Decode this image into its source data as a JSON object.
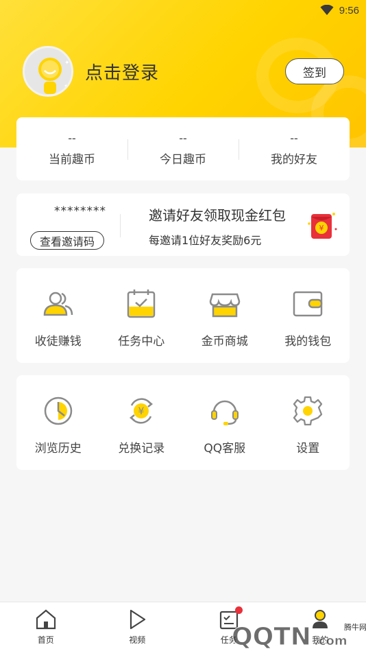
{
  "status_bar": {
    "time": "9:56",
    "wifi_icon": "wifi-icon"
  },
  "profile": {
    "login_text": "点击登录",
    "signin_label": "签到"
  },
  "stats": [
    {
      "value": "--",
      "label": "当前趣币"
    },
    {
      "value": "--",
      "label": "今日趣币"
    },
    {
      "value": "--",
      "label": "我的好友"
    }
  ],
  "invite": {
    "code": "********",
    "view_code_label": "查看邀请码",
    "title": "邀请好友领取现金红包",
    "subtitle": "每邀请1位好友奖励6元",
    "icon": "red-packet-icon"
  },
  "menu_row1": [
    {
      "label": "收徒赚钱",
      "icon": "users-icon"
    },
    {
      "label": "任务中心",
      "icon": "calendar-check-icon"
    },
    {
      "label": "金币商城",
      "icon": "shop-icon"
    },
    {
      "label": "我的钱包",
      "icon": "wallet-icon"
    }
  ],
  "menu_row2": [
    {
      "label": "浏览历史",
      "icon": "clock-icon"
    },
    {
      "label": "兑换记录",
      "icon": "yen-exchange-icon"
    },
    {
      "label": "QQ客服",
      "icon": "headset-icon"
    },
    {
      "label": "设置",
      "icon": "gear-icon"
    }
  ],
  "tabbar": [
    {
      "label": "首页",
      "icon": "home-icon"
    },
    {
      "label": "视频",
      "icon": "play-icon"
    },
    {
      "label": "任务",
      "icon": "task-icon"
    },
    {
      "label": "我的",
      "icon": "profile-icon"
    }
  ],
  "watermark": {
    "text": "QQTN.com",
    "sub": "腾牛网"
  },
  "colors": {
    "accent": "#ffd400",
    "icon_gray": "#8a8a8a",
    "red": "#e8313a"
  }
}
